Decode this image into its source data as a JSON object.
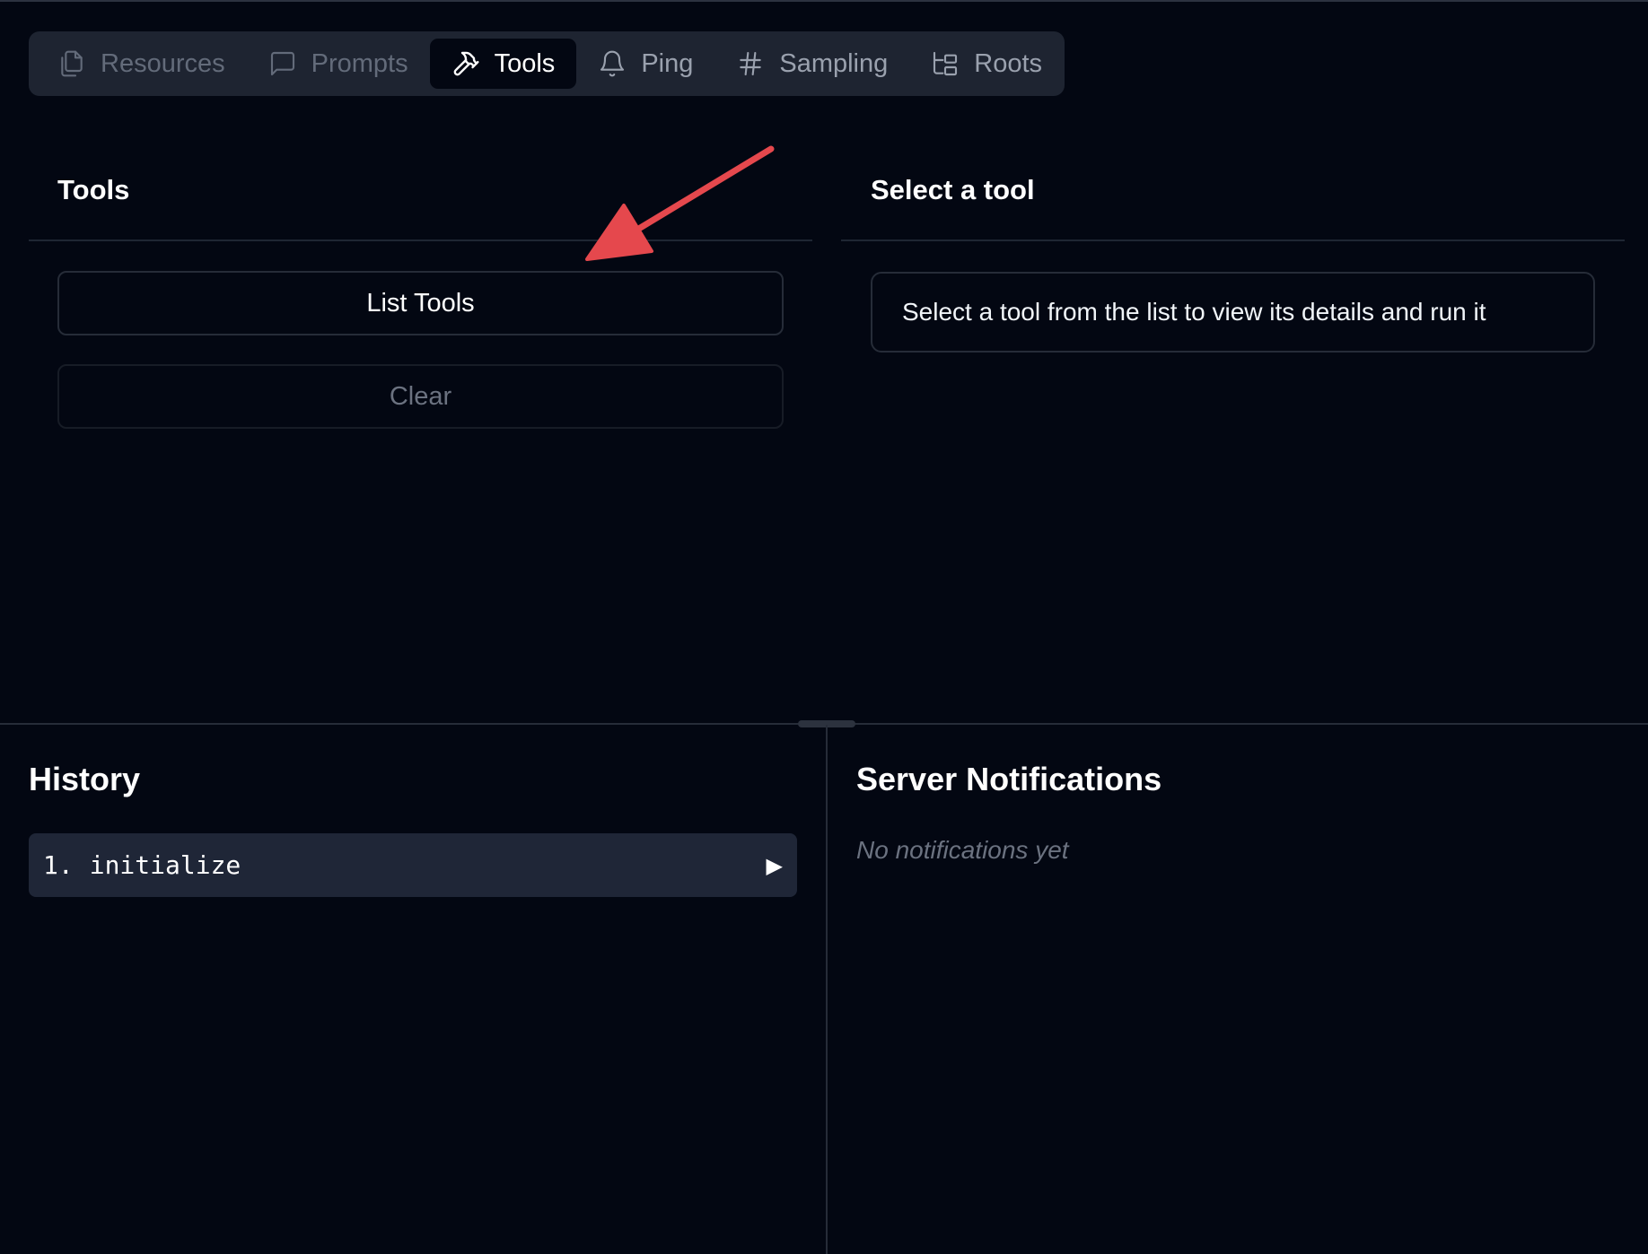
{
  "tabs": [
    {
      "label": "Resources",
      "icon": "files-icon"
    },
    {
      "label": "Prompts",
      "icon": "message-square-icon"
    },
    {
      "label": "Tools",
      "icon": "hammer-icon"
    },
    {
      "label": "Ping",
      "icon": "bell-icon"
    },
    {
      "label": "Sampling",
      "icon": "hash-icon"
    },
    {
      "label": "Roots",
      "icon": "folder-tree-icon"
    }
  ],
  "active_tab": "Tools",
  "tools_panel": {
    "title": "Tools",
    "list_button": "List Tools",
    "clear_button": "Clear"
  },
  "detail_panel": {
    "title": "Select a tool",
    "placeholder": "Select a tool from the list to view its details and run it"
  },
  "history": {
    "title": "History",
    "items": [
      {
        "index": "1.",
        "method": "initialize"
      }
    ]
  },
  "notifications": {
    "title": "Server Notifications",
    "empty": "No notifications yet"
  },
  "colors": {
    "background": "#030712",
    "tab_bar": "#1e2431",
    "annotation_arrow": "#e5484d"
  }
}
